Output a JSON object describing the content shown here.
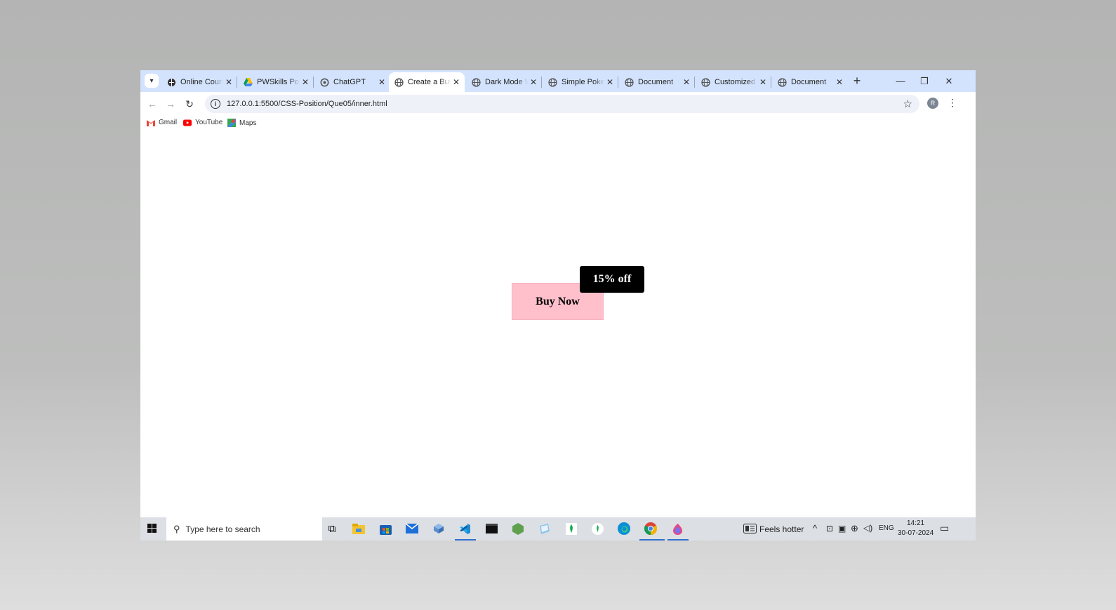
{
  "browser": {
    "tabs": [
      {
        "title": "Online Courses",
        "active": false,
        "icon": "globe-icon"
      },
      {
        "title": "PWSkills Position",
        "active": false,
        "icon": "drive-icon"
      },
      {
        "title": "ChatGPT",
        "active": false,
        "icon": "chatgpt-icon"
      },
      {
        "title": "Create a Button",
        "active": true,
        "icon": "globe-icon"
      },
      {
        "title": "Dark Mode Web",
        "active": false,
        "icon": "globe-icon"
      },
      {
        "title": "Simple Poker",
        "active": false,
        "icon": "globe-icon"
      },
      {
        "title": "Document",
        "active": false,
        "icon": "globe-icon"
      },
      {
        "title": "Customized B",
        "active": false,
        "icon": "globe-icon"
      },
      {
        "title": "Document",
        "active": false,
        "icon": "globe-icon"
      }
    ],
    "url": "127.0.0.1:5500/CSS-Position/Que05/inner.html",
    "profile_initial": "R",
    "bookmarks": [
      {
        "label": "Gmail",
        "icon": "gmail-icon"
      },
      {
        "label": "YouTube",
        "icon": "youtube-icon"
      },
      {
        "label": "Maps",
        "icon": "maps-icon"
      }
    ]
  },
  "page": {
    "button_label": "Buy Now",
    "badge_label": "15% off",
    "button_color": "#ffc0cb",
    "badge_color": "#000000"
  },
  "taskbar": {
    "search_placeholder": "Type here to search",
    "weather": "Feels hotter",
    "language": "ENG",
    "time": "14:21",
    "date": "30-07-2024"
  }
}
